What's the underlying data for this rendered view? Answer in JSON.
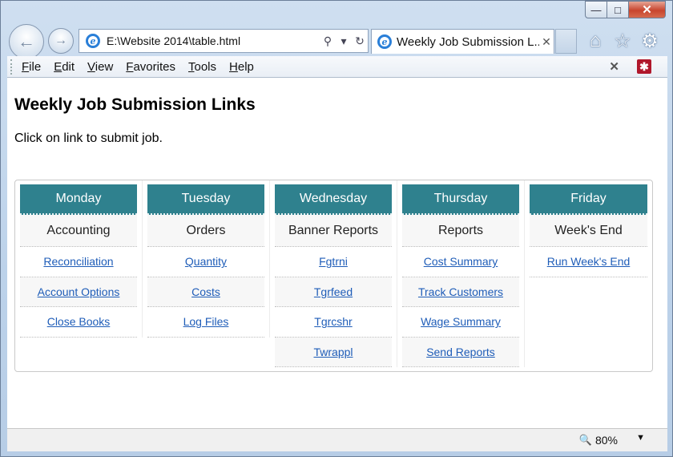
{
  "browser": {
    "address_url": "E:\\Website 2014\\table.html",
    "tab_title": "Weekly Job Submission L...",
    "menu": [
      "File",
      "Edit",
      "View",
      "Favorites",
      "Tools",
      "Help"
    ],
    "zoom": "80%"
  },
  "page": {
    "title": "Weekly Job Submission Links",
    "subtitle": "Click on link to submit job.",
    "columns": [
      {
        "day": "Monday",
        "category": "Accounting",
        "links": [
          "Reconciliation",
          "Account Options",
          "Close Books"
        ]
      },
      {
        "day": "Tuesday",
        "category": "Orders",
        "links": [
          "Quantity",
          "Costs",
          "Log Files"
        ]
      },
      {
        "day": "Wednesday",
        "category": "Banner Reports",
        "links": [
          "Fgtrni",
          "Tgrfeed",
          "Tgrcshr",
          "Twrappl"
        ]
      },
      {
        "day": "Thursday",
        "category": "Reports",
        "links": [
          "Cost Summary",
          "Track Customers",
          "Wage Summary",
          "Send Reports"
        ]
      },
      {
        "day": "Friday",
        "category": "Week's End",
        "links": [
          "Run Week's End"
        ]
      }
    ]
  },
  "colors": {
    "header_accent": "#2f818e",
    "link": "#1f5db8"
  }
}
